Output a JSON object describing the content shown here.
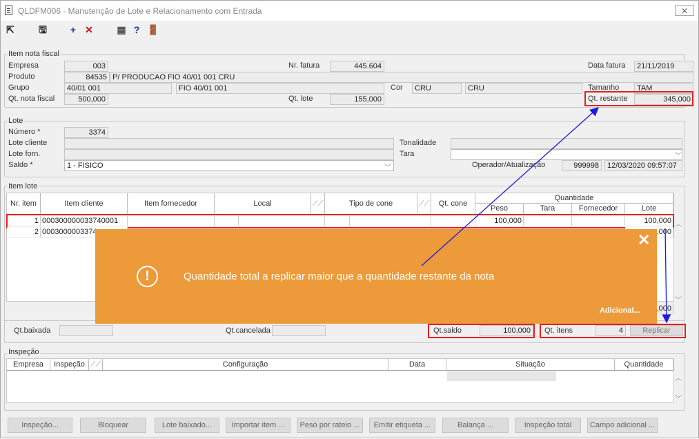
{
  "window": {
    "title": "QLDFM006 - Manutenção de Lote e Relacionamento com Entrada",
    "close": "⨯"
  },
  "toolbar": [
    {
      "name": "exit-icon",
      "glyph": "⇱",
      "color": "#222"
    },
    {
      "name": "save-icon",
      "glyph": "🖫",
      "color": "#222"
    },
    {
      "name": "add-icon",
      "glyph": "+",
      "color": "#1030a0"
    },
    {
      "name": "delete-icon",
      "glyph": "✕",
      "color": "#d01010"
    },
    {
      "name": "calendar-icon",
      "glyph": "▦",
      "color": "#555"
    },
    {
      "name": "help-icon",
      "glyph": "?",
      "color": "#1030a0"
    },
    {
      "name": "door-exit-icon",
      "glyph": "🚪",
      "color": "#c8a000"
    }
  ],
  "item_nota": {
    "legend": "Item nota fiscal",
    "empresa_label": "Empresa",
    "empresa": "003",
    "nr_fatura_label": "Nr. fatura",
    "nr_fatura": "445.604",
    "data_fatura_label": "Data fatura",
    "data_fatura": "21/11/2019",
    "produto_label": "Produto",
    "produto_code": "84535",
    "produto_desc": "P/ PRODUCAO FIO 40/01 001 CRU",
    "grupo_label": "Grupo",
    "grupo_code": "40/01 001",
    "grupo_desc": "FIO 40/01 001",
    "cor_label": "Cor",
    "cor_code": "CRU",
    "cor_desc": "CRU",
    "tamanho_label": "Tamanho",
    "tamanho": "TAM",
    "qt_nota_label": "Qt. nota fiscal",
    "qt_nota": "500,000",
    "qt_lote_label": "Qt. lote",
    "qt_lote": "155,000",
    "qt_restante_label": "Qt. restante",
    "qt_restante": "345,000"
  },
  "lote": {
    "legend": "Lote",
    "numero_label": "Número *",
    "numero": "3374",
    "lote_cliente_label": "Lote cliente",
    "lote_cliente": "",
    "tonalidade_label": "Tonalidade",
    "tonalidade": "",
    "lote_forn_label": "Lote forn.",
    "lote_forn": "",
    "tara_label": "Tara",
    "tara": "",
    "saldo_label": "Saldo *",
    "saldo": "1 - FISICO",
    "operador_label": "Operador/Atualização",
    "operador": "999998",
    "atualizacao": "12/03/2020 09:57:07"
  },
  "item_lote": {
    "legend": "Item lote",
    "columns": {
      "nr_item": "Nr. item",
      "item_cliente": "Item cliente",
      "item_fornecedor": "Item fornecedor",
      "local": "Local",
      "tipo_cone": "Tipo de cone",
      "qt_cone": "Qt. cone",
      "quantidade": "Quantidade",
      "peso": "Peso",
      "tara": "Tara",
      "fornecedor": "Fornecedor",
      "lote": "Lote"
    },
    "rows": [
      {
        "nr_item": "1",
        "item_cliente": "000300000033740001",
        "peso": "100,000",
        "lote": "100,000"
      },
      {
        "nr_item": "2",
        "item_cliente": "0003000003374",
        "lote": ",000"
      }
    ],
    "total_lote": ",000",
    "qt_baixada_label": "Qt.baixada",
    "qt_baixada": "",
    "qt_cancelada_label": "Qt.cancelada",
    "qt_cancelada": "",
    "qt_saldo_label": "Qt.saldo",
    "qt_saldo": "100,000",
    "qt_itens_label": "Qt. itens",
    "qt_itens": "4",
    "replicar": "Replicar"
  },
  "inspecao": {
    "legend": "Inspeção",
    "columns": {
      "empresa": "Empresa",
      "inspecao": "Inspeção",
      "configuracao": "Configuração",
      "data": "Data",
      "situacao": "Situação",
      "quantidade": "Quantidade"
    }
  },
  "buttons": [
    "Inspeção...",
    "Bloquear",
    "Lote baixado...",
    "Importar item ...",
    "Peso por rateio ...",
    "Emitir etiqueta ...",
    "Balança ...",
    "Inspeção total",
    "Campo adicional ..."
  ],
  "toast": {
    "message": "Quantidade total a replicar maior que a quantidade restante da nota",
    "additional": "Adicional...",
    "close": "✕",
    "icon": "!"
  },
  "colors": {
    "toast": "#ec9a3a",
    "highlight": "#e02020",
    "arrow": "#1a1ae0"
  }
}
